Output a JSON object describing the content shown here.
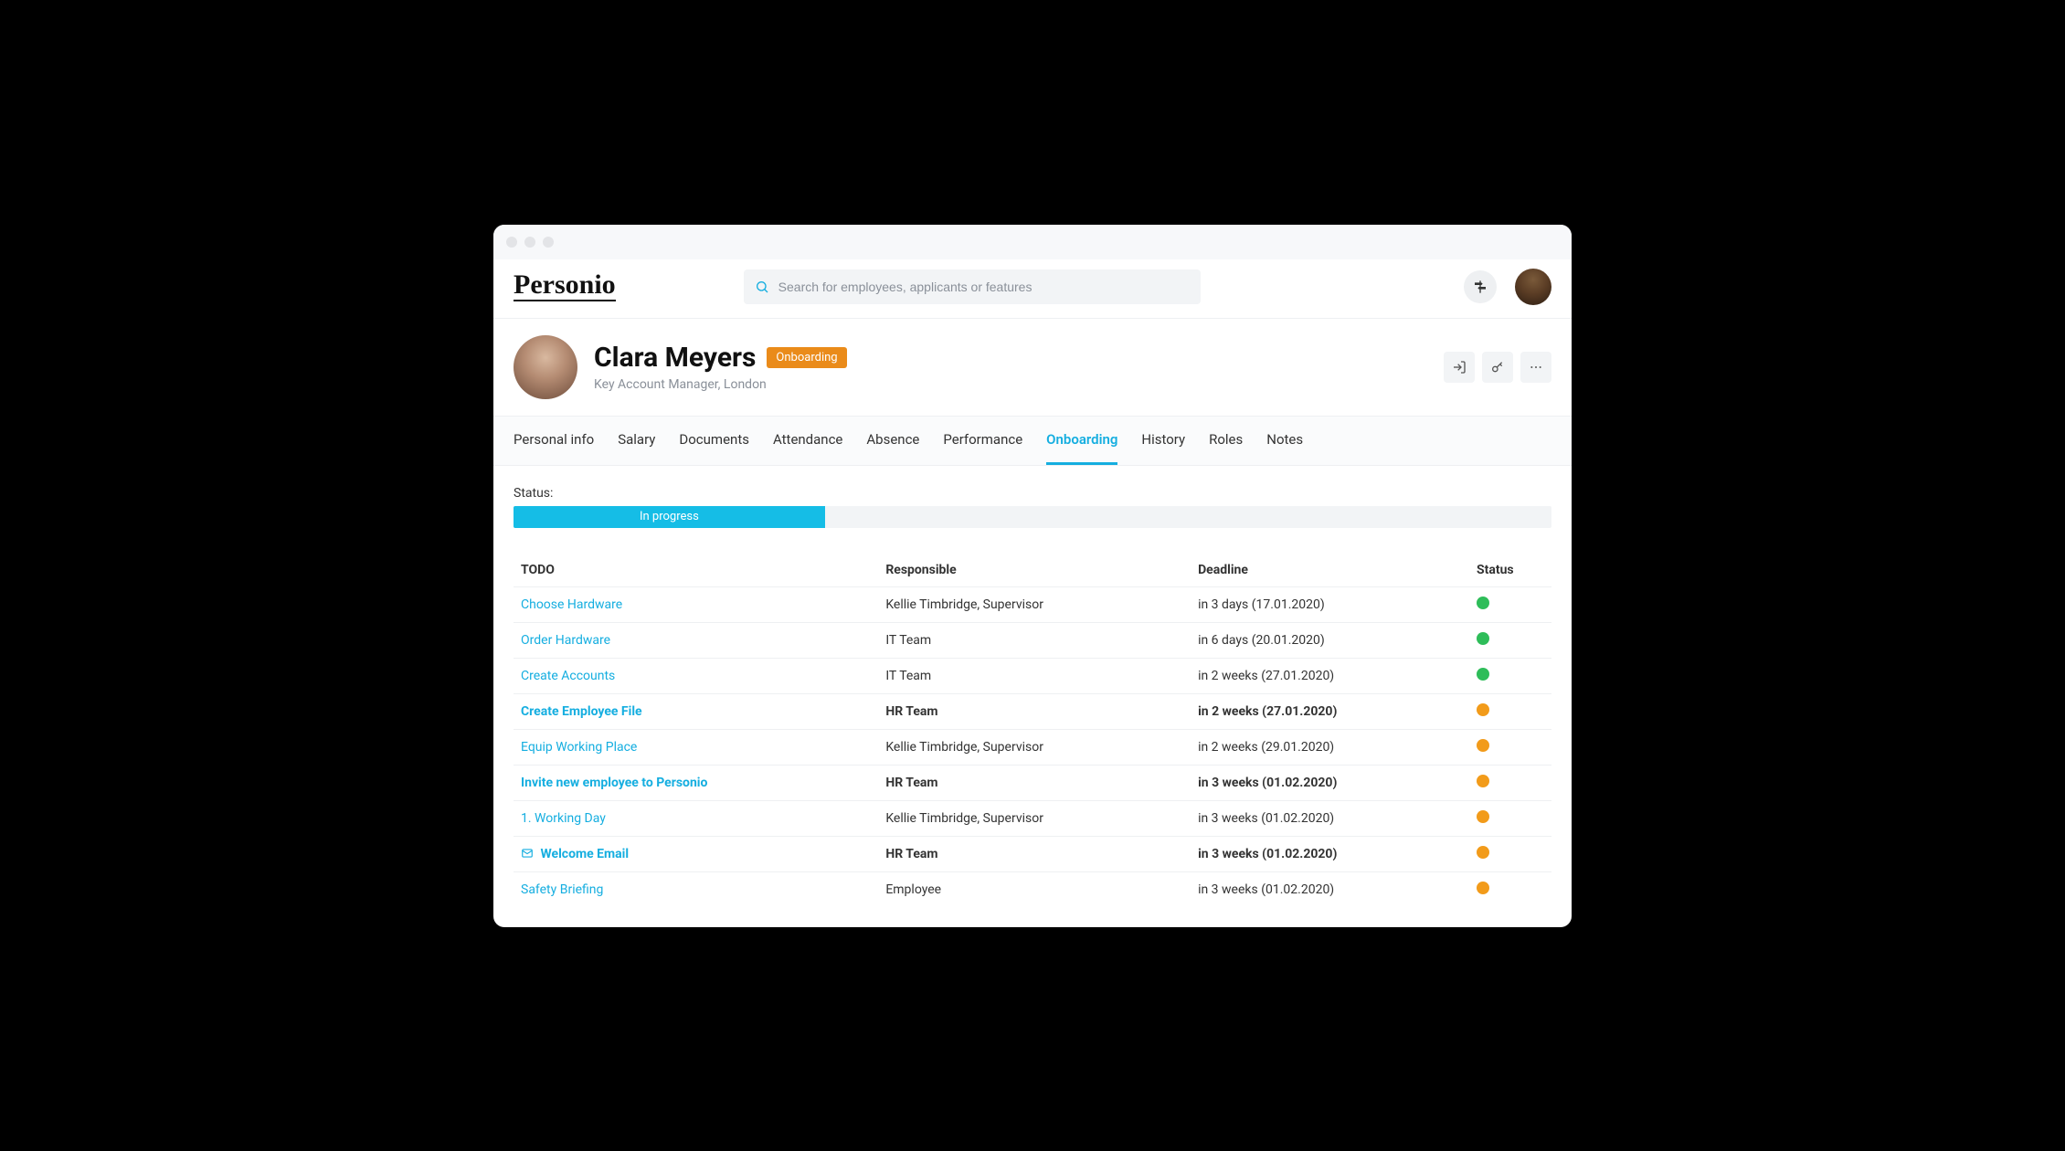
{
  "brand": "Personio",
  "search": {
    "placeholder": "Search for employees, applicants or features"
  },
  "profile": {
    "name": "Clara Meyers",
    "badge": "Onboarding",
    "subtitle": "Key Account Manager, London"
  },
  "tabs": [
    {
      "label": "Personal info",
      "active": false
    },
    {
      "label": "Salary",
      "active": false
    },
    {
      "label": "Documents",
      "active": false
    },
    {
      "label": "Attendance",
      "active": false
    },
    {
      "label": "Absence",
      "active": false
    },
    {
      "label": "Performance",
      "active": false
    },
    {
      "label": "Onboarding",
      "active": true
    },
    {
      "label": "History",
      "active": false
    },
    {
      "label": "Roles",
      "active": false
    },
    {
      "label": "Notes",
      "active": false
    }
  ],
  "status": {
    "label": "Status:",
    "text": "In progress",
    "percent": 30
  },
  "table": {
    "headers": {
      "todo": "TODO",
      "responsible": "Responsible",
      "deadline": "Deadline",
      "status": "Status"
    },
    "rows": [
      {
        "todo": "Choose Hardware",
        "responsible": "Kellie Timbridge, Supervisor",
        "deadline": "in 3 days (17.01.2020)",
        "status": "green",
        "bold": false,
        "mail": false
      },
      {
        "todo": "Order Hardware",
        "responsible": "IT Team",
        "deadline": "in 6 days (20.01.2020)",
        "status": "green",
        "bold": false,
        "mail": false
      },
      {
        "todo": "Create Accounts",
        "responsible": "IT Team",
        "deadline": "in 2 weeks (27.01.2020)",
        "status": "green",
        "bold": false,
        "mail": false
      },
      {
        "todo": "Create Employee File",
        "responsible": "HR Team",
        "deadline": "in 2 weeks (27.01.2020)",
        "status": "orange",
        "bold": true,
        "mail": false
      },
      {
        "todo": "Equip Working Place",
        "responsible": "Kellie Timbridge, Supervisor",
        "deadline": "in 2 weeks (29.01.2020)",
        "status": "orange",
        "bold": false,
        "mail": false
      },
      {
        "todo": "Invite new employee to Personio",
        "responsible": "HR Team",
        "deadline": "in 3 weeks (01.02.2020)",
        "status": "orange",
        "bold": true,
        "mail": false
      },
      {
        "todo": "1. Working Day",
        "responsible": "Kellie Timbridge, Supervisor",
        "deadline": "in 3 weeks (01.02.2020)",
        "status": "orange",
        "bold": false,
        "mail": false
      },
      {
        "todo": "Welcome Email",
        "responsible": "HR Team",
        "deadline": "in 3 weeks (01.02.2020)",
        "status": "orange",
        "bold": true,
        "mail": true
      },
      {
        "todo": "Safety Briefing",
        "responsible": "Employee",
        "deadline": "in 3 weeks (01.02.2020)",
        "status": "orange",
        "bold": false,
        "mail": false
      }
    ]
  }
}
